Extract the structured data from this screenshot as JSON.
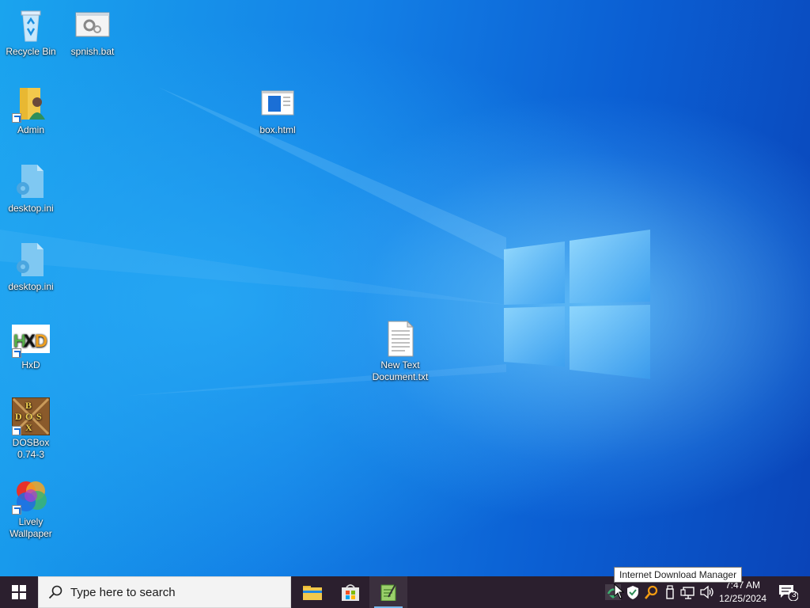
{
  "desktop": {
    "icons": [
      {
        "label": "Recycle Bin"
      },
      {
        "label": "spnish.bat"
      },
      {
        "label": "Admin"
      },
      {
        "label": "box.html"
      },
      {
        "label": "desktop.ini"
      },
      {
        "label": "desktop.ini"
      },
      {
        "label": "HxD"
      },
      {
        "label": "New Text Document.txt"
      },
      {
        "label": "DOSBox 0.74-3"
      },
      {
        "label": "Lively Wallpaper"
      }
    ]
  },
  "taskbar": {
    "search_placeholder": "Type here to search",
    "pinned": [
      "file-explorer",
      "microsoft-store",
      "notepad-plus-plus"
    ],
    "clock_time": "7:47 AM",
    "clock_date": "12/25/2024",
    "notification_count": "3"
  },
  "tooltip": {
    "text": "Internet Download Manager"
  },
  "colors": {
    "taskbar": "#2b1f2e",
    "accent": "#0a5fd6"
  }
}
